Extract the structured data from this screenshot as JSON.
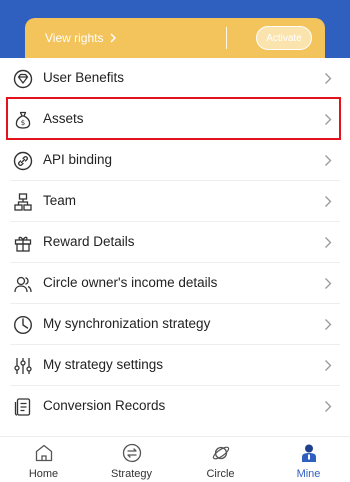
{
  "banner": {
    "view_rights": "View rights",
    "activate": "Activate"
  },
  "menu": {
    "items": [
      {
        "label": "User Benefits",
        "icon": "diamond-icon"
      },
      {
        "label": "Assets",
        "icon": "money-bag-icon"
      },
      {
        "label": "API binding",
        "icon": "link-icon"
      },
      {
        "label": "Team",
        "icon": "org-chart-icon"
      },
      {
        "label": "Reward Details",
        "icon": "gift-icon"
      },
      {
        "label": "Circle owner's income details",
        "icon": "users-icon"
      },
      {
        "label": "My synchronization strategy",
        "icon": "pie-clock-icon"
      },
      {
        "label": "My strategy settings",
        "icon": "sliders-icon"
      },
      {
        "label": "Conversion Records",
        "icon": "records-icon"
      }
    ]
  },
  "tabs": [
    {
      "label": "Home",
      "icon": "home-icon"
    },
    {
      "label": "Strategy",
      "icon": "exchange-icon"
    },
    {
      "label": "Circle",
      "icon": "planet-icon"
    },
    {
      "label": "Mine",
      "icon": "person-icon",
      "active": true
    }
  ],
  "colors": {
    "brand_blue": "#2f5fbf",
    "gold": "#f4c45c",
    "highlight_red": "#e3131b"
  }
}
